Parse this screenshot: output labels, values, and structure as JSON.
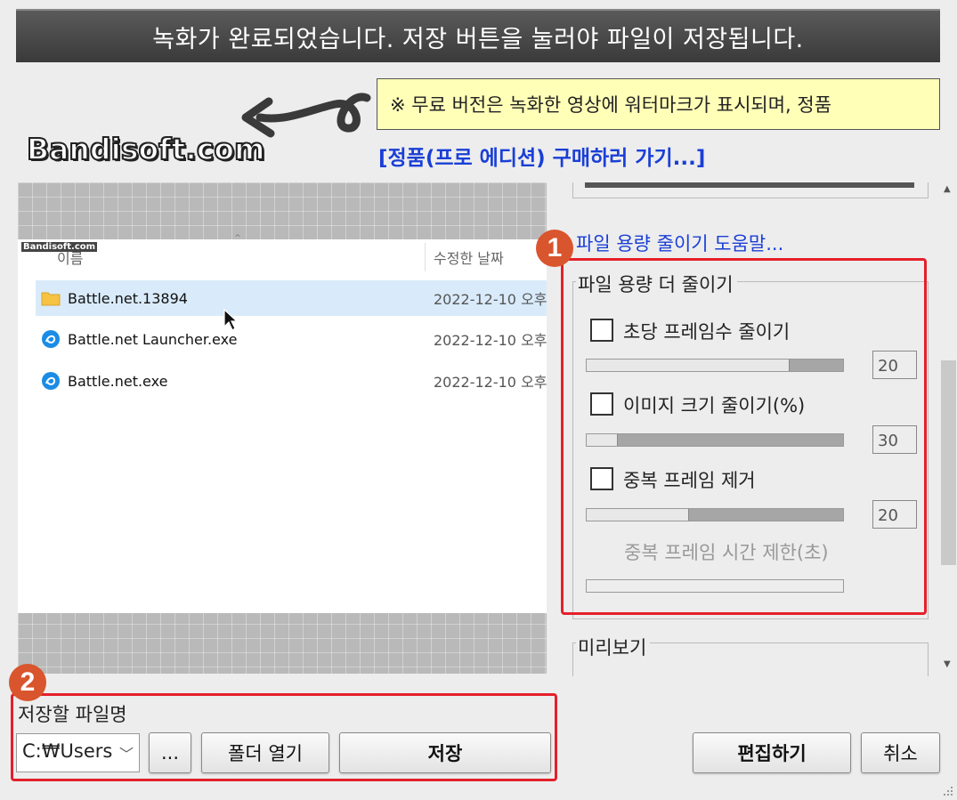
{
  "banner": {
    "text": "녹화가 완료되었습니다. 저장 버튼을 눌러야 파일이 저장됩니다."
  },
  "notice": {
    "text": "※ 무료 버전은 녹화한 영상에 워터마크가 표시되며, 정품"
  },
  "buy_link": "[정품(프로 에디션) 구매하러 가기...]",
  "watermark": {
    "logo": "Bandisoft.com",
    "small": "Bandisoft.com"
  },
  "explorer": {
    "columns": [
      "이름",
      "수정한 날짜"
    ],
    "rows": [
      {
        "name": "Battle.net.13894",
        "date": "2022-12-10 오후",
        "icon": "folder-icon",
        "selected": true
      },
      {
        "name": "Battle.net Launcher.exe",
        "date": "2022-12-10 오후",
        "icon": "battlenet-icon",
        "selected": false
      },
      {
        "name": "Battle.net.exe",
        "date": "2022-12-10 오후",
        "icon": "battlenet-icon",
        "selected": false
      }
    ]
  },
  "right_panel": {
    "help_link": "파일 용량 줄이기 도움말...",
    "group_title": "파일 용량 더 줄이기",
    "options": [
      {
        "label": "초당 프레임수 줄이기",
        "value": "20",
        "level": 0.79,
        "checked": false
      },
      {
        "label": "이미지 크기 줄이기(%)",
        "value": "30",
        "level": 0.12,
        "checked": false
      },
      {
        "label": "중복 프레임 제거",
        "value": "20",
        "level": 0.4,
        "checked": false
      }
    ],
    "sub_label": "중복 프레임 시간 제한(초)",
    "preview_title": "미리보기"
  },
  "badges": [
    "1",
    "2"
  ],
  "bottom": {
    "save_label": "저장할 파일명",
    "path_value": "C:₩Users",
    "browse_label": "...",
    "open_folder_label": "폴더 열기",
    "save_label_btn": "저장",
    "edit_label": "편집하기",
    "cancel_label": "취소"
  },
  "colors": {
    "highlight": "#e4202a",
    "badge": "#d9552d",
    "link": "#1a3fd6",
    "notice_bg": "#ffffb8"
  }
}
